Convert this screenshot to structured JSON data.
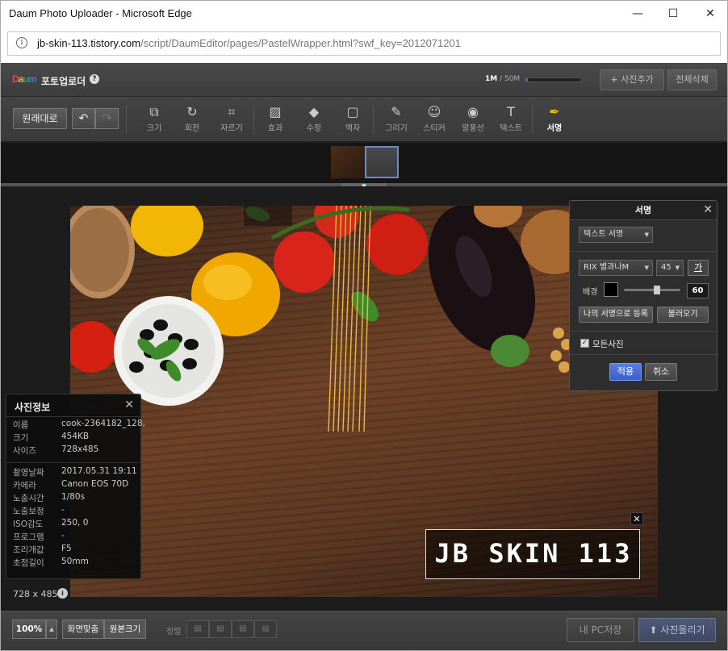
{
  "window": {
    "title": "Daum Photo Uploader - Microsoft Edge",
    "minimize_glyph": "—",
    "maximize_glyph": "☐",
    "close_glyph": "✕"
  },
  "address": {
    "url_host": "jb-skin-113.tistory.com",
    "url_path": "/script/DaumEditor/pages/PastelWrapper.html?swf_key=2012071201",
    "info_icon": "i"
  },
  "header": {
    "logo": {
      "d": "D",
      "a": "a",
      "u": "u",
      "m": "m"
    },
    "title": "포토업로더",
    "help_icon": "?",
    "quota_used": "1M",
    "quota_sep": " / ",
    "quota_total": "50M",
    "quota_fraction": 0.04,
    "add_photo_label": "사진추가",
    "add_photo_icon": "plus-icon",
    "delete_all_label": "전체삭제"
  },
  "toolbar": {
    "original_label": "원래대로",
    "undo_icon": "undo-icon",
    "redo_icon": "redo-icon",
    "tools": [
      {
        "key": "resize",
        "label": "크기",
        "icon": "⧉",
        "icon_name": "resize-icon"
      },
      {
        "key": "rotate",
        "label": "회전",
        "icon": "↻",
        "icon_name": "rotate-icon"
      },
      {
        "key": "crop",
        "label": "자르기",
        "icon": "⌗",
        "icon_name": "crop-icon"
      },
      {
        "key": "effect",
        "label": "효과",
        "icon": "▨",
        "icon_name": "effect-icon"
      },
      {
        "key": "retouch",
        "label": "수정",
        "icon": "◆",
        "icon_name": "eraser-icon"
      },
      {
        "key": "frame",
        "label": "액자",
        "icon": "▢",
        "icon_name": "frame-icon"
      },
      {
        "key": "draw",
        "label": "그리기",
        "icon": "✎",
        "icon_name": "brush-icon"
      },
      {
        "key": "sticker",
        "label": "스티커",
        "icon": "☺",
        "icon_name": "sticker-icon"
      },
      {
        "key": "bubble",
        "label": "말풍선",
        "icon": "◉",
        "icon_name": "speech-bubble-icon"
      },
      {
        "key": "text",
        "label": "텍스트",
        "icon": "T",
        "icon_name": "text-icon"
      },
      {
        "key": "signature",
        "label": "서명",
        "icon": "✒",
        "icon_name": "pen-nib-icon"
      }
    ],
    "active_tool": "signature"
  },
  "canvas": {
    "image_size": "728 x 485",
    "size_info_icon": "i",
    "signature_text": "JB SKIN 113",
    "signature_close": "✕"
  },
  "photo_info": {
    "title": "사진정보",
    "close": "✕",
    "rows": [
      {
        "label": "이름",
        "value": "cook-2364182_128,"
      },
      {
        "label": "크기",
        "value": "454KB"
      },
      {
        "label": "사이즈",
        "value": "728x485"
      },
      {
        "label": "촬영날짜",
        "value": "2017.05.31 19:11"
      },
      {
        "label": "카메라",
        "value": "Canon EOS 70D"
      },
      {
        "label": "노출시간",
        "value": "1/80s"
      },
      {
        "label": "노출보정",
        "value": "-"
      },
      {
        "label": "ISO감도",
        "value": "250, 0"
      },
      {
        "label": "프로그램",
        "value": "-"
      },
      {
        "label": "조리개값",
        "value": "F5"
      },
      {
        "label": "초점길이",
        "value": "50mm"
      }
    ]
  },
  "signature_panel": {
    "title": "서명",
    "close": "✕",
    "type_select": "텍스트 서명",
    "font_select": "RIX 별과나M",
    "size_select": "45",
    "ga_button": "가",
    "bg_label": "배경",
    "bg_color": "#000000",
    "opacity": "60",
    "opacity_fraction": 0.6,
    "register_label": "나의 서명으로 등록",
    "load_label": "불러오기",
    "all_photos_label": "모든사진",
    "all_photos_checked": "✓",
    "apply_label": "적용",
    "cancel_label": "취소"
  },
  "bottom": {
    "zoom": "100%",
    "fit_label": "화면맞춤",
    "original_size_label": "원본크기",
    "align_label": "정렬",
    "align_icons": [
      "align-left-icon",
      "align-center-icon",
      "align-right-icon",
      "align-justify-icon"
    ],
    "save_pc_label": "내 PC저장",
    "upload_label": "사진올리기",
    "upload_icon": "upload-arrow-icon"
  }
}
